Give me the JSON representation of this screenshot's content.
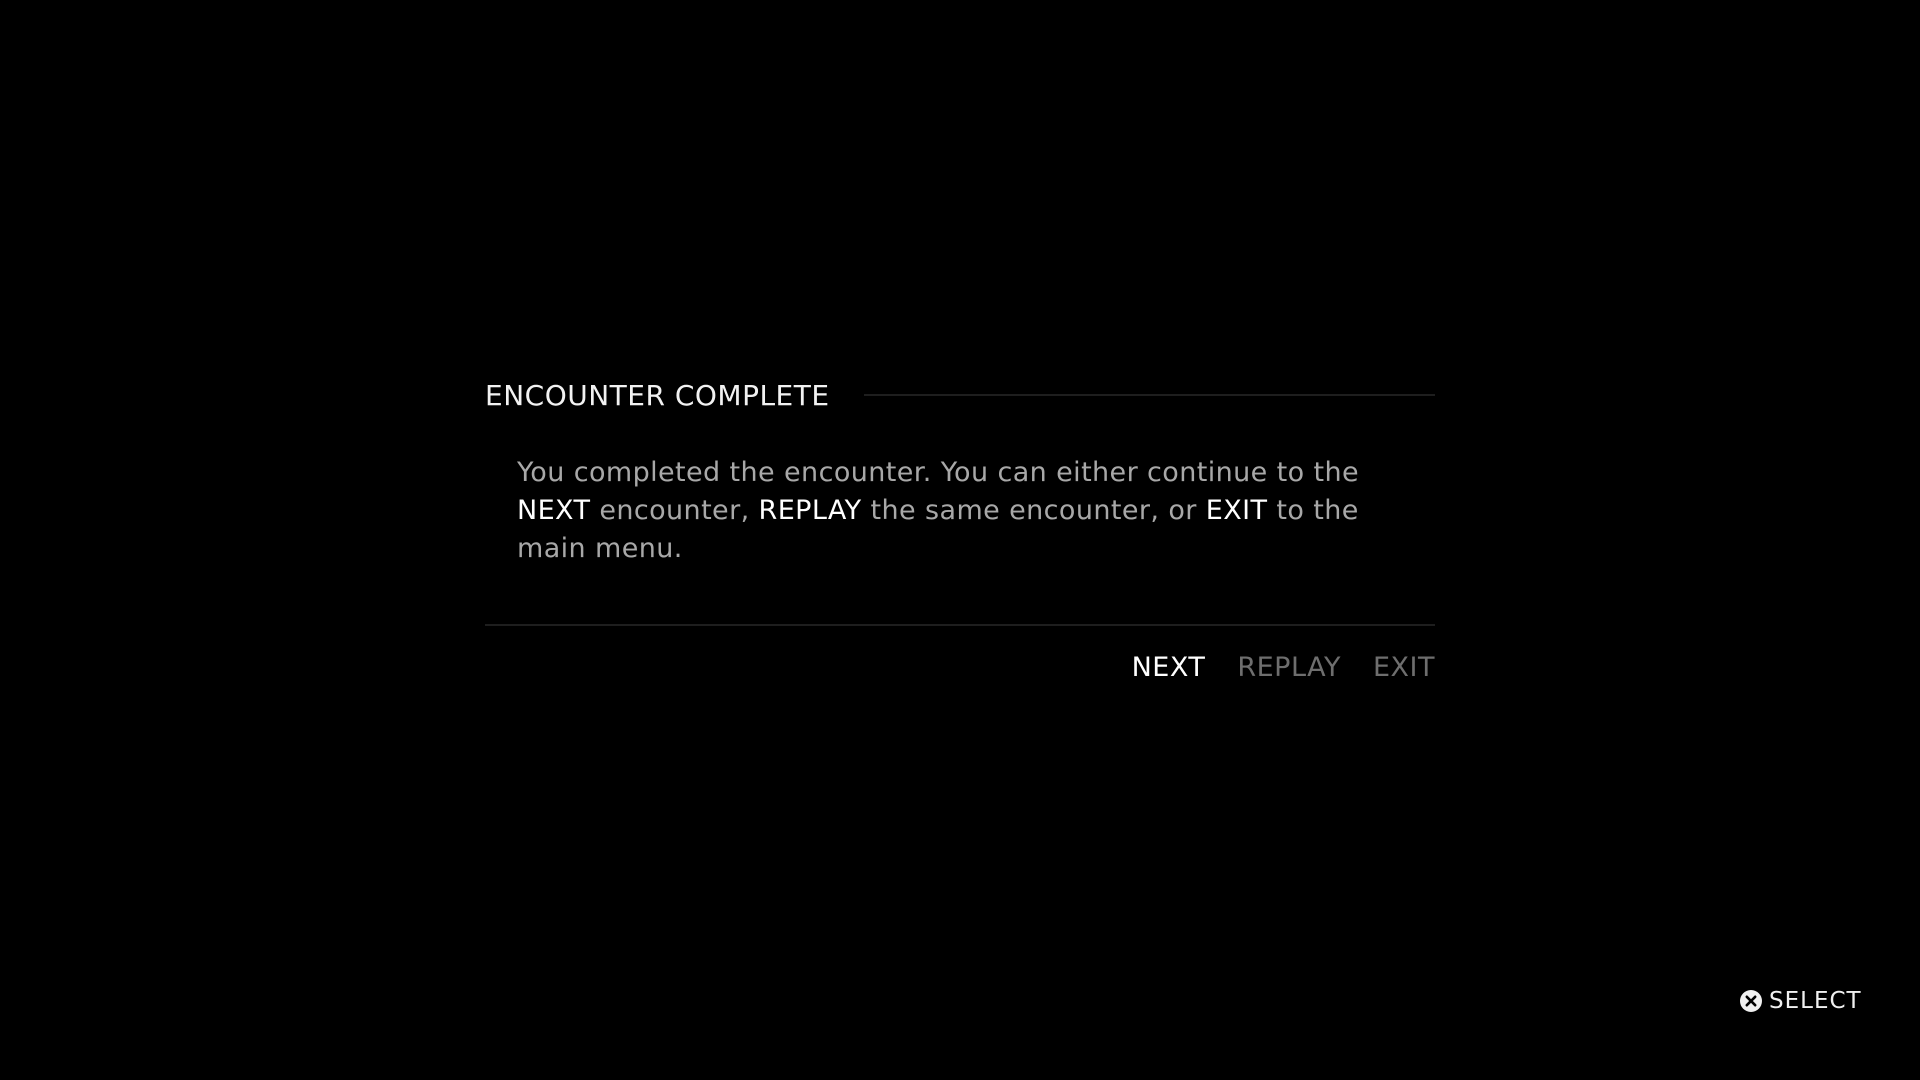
{
  "dialog": {
    "title": "ENCOUNTER COMPLETE",
    "body": {
      "segments": [
        {
          "text": "You completed the encounter. You can either continue to the ",
          "emphasis": false
        },
        {
          "text": "NEXT",
          "emphasis": true
        },
        {
          "text": " encounter, ",
          "emphasis": false
        },
        {
          "text": "REPLAY",
          "emphasis": true
        },
        {
          "text": " the same encounter, or ",
          "emphasis": false
        },
        {
          "text": "EXIT",
          "emphasis": true
        },
        {
          "text": " to the main menu.",
          "emphasis": false
        }
      ]
    },
    "options": [
      {
        "label": "NEXT",
        "selected": true
      },
      {
        "label": "REPLAY",
        "selected": false
      },
      {
        "label": "EXIT",
        "selected": false
      }
    ]
  },
  "prompt": {
    "icon": "cross-button-icon",
    "label": "SELECT"
  },
  "colors": {
    "background": "#000000",
    "selected": "#ffffff",
    "unselected": "#6e6e6e",
    "body_text": "#a8a8a8"
  }
}
